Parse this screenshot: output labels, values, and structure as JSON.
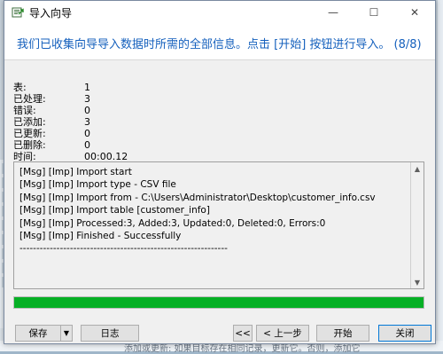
{
  "window": {
    "title": "导入向导",
    "min_glyph": "—",
    "max_glyph": "☐",
    "close_glyph": "✕"
  },
  "header": {
    "message": "我们已收集向导导入数据时所需的全部信息。点击 [开始] 按钮进行导入。 (8/8)"
  },
  "stats": [
    {
      "label": "表:",
      "value": "1"
    },
    {
      "label": "已处理:",
      "value": "3"
    },
    {
      "label": "错误:",
      "value": "0"
    },
    {
      "label": "已添加:",
      "value": "3"
    },
    {
      "label": "已更新:",
      "value": "0"
    },
    {
      "label": "已删除:",
      "value": "0"
    },
    {
      "label": "时间:",
      "value": "00:00.12"
    }
  ],
  "log": {
    "lines": [
      "[Msg] [Imp] Import start",
      "[Msg] [Imp] Import type - CSV file",
      "[Msg] [Imp] Import from - C:\\Users\\Administrator\\Desktop\\customer_info.csv",
      "[Msg] [Imp] Import table [customer_info]",
      "[Msg] [Imp] Processed:3, Added:3, Updated:0, Deleted:0, Errors:0",
      "[Msg] [Imp] Finished - Successfully"
    ],
    "separator": "--------------------------------------------------------------"
  },
  "progress": {
    "percent": 100,
    "color": "#06b025"
  },
  "footer": {
    "save_label": "保存",
    "log_label": "日志",
    "first_label": "<<",
    "prev_label": "< 上一步",
    "start_label": "开始",
    "close_label": "关闭"
  },
  "background": {
    "snippet": "添加或更新: 如果目标存在相同记录，更新它。否则，添加它"
  }
}
